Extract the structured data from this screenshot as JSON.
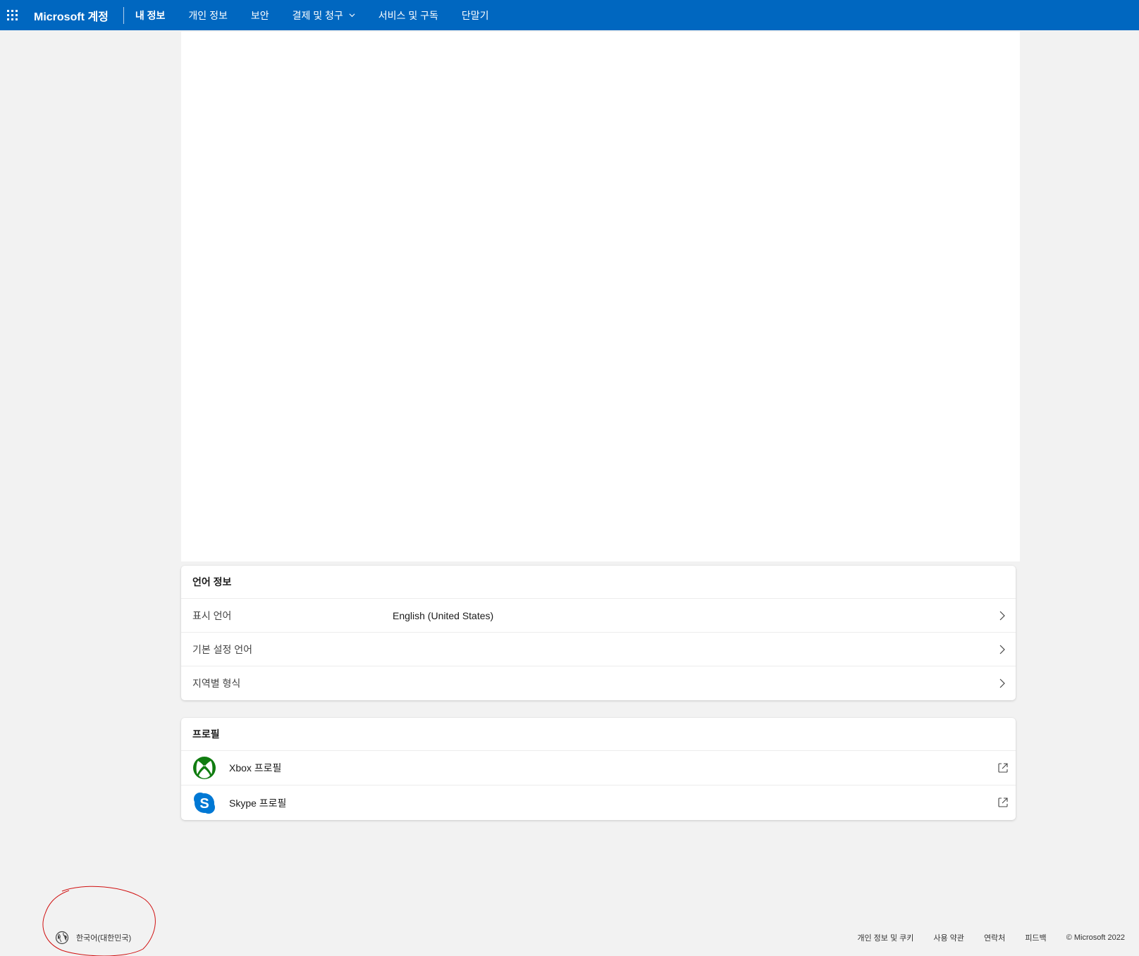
{
  "topnav": {
    "brand": "Microsoft 계정",
    "items": [
      {
        "label": "내 정보",
        "active": true
      },
      {
        "label": "개인 정보"
      },
      {
        "label": "보안"
      },
      {
        "label": "결제 및 청구",
        "dropdown": true
      },
      {
        "label": "서비스 및 구독"
      },
      {
        "label": "단말기"
      }
    ],
    "accent_color": "#0067c0"
  },
  "language_card": {
    "title": "언어 정보",
    "rows": [
      {
        "label": "표시 언어",
        "value": "English (United States)"
      },
      {
        "label": "기본 설정 언어",
        "value": ""
      },
      {
        "label": "지역별 형식",
        "value": ""
      }
    ]
  },
  "profile_card": {
    "title": "프로필",
    "rows": [
      {
        "label": "Xbox 프로필",
        "icon": "xbox-icon"
      },
      {
        "label": "Skype 프로필",
        "icon": "skype-icon"
      }
    ]
  },
  "footer": {
    "language": "한국어(대한민국)",
    "links": [
      "개인 정보 및 쿠키",
      "사용 약관",
      "연락처",
      "피드백"
    ],
    "copyright": "© Microsoft 2022"
  }
}
